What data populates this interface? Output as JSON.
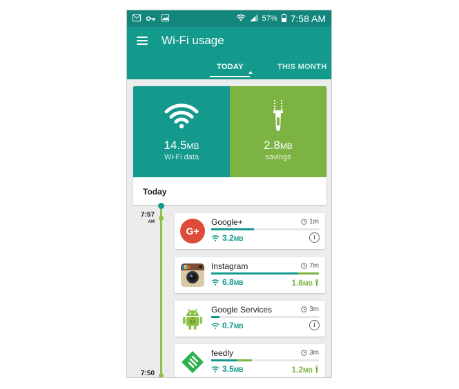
{
  "status_bar": {
    "battery": "57%",
    "time": "7:58 AM"
  },
  "header": {
    "title": "Wi-Fi usage"
  },
  "tabs": [
    {
      "label": "TODAY",
      "selected": true
    },
    {
      "label": "THIS MONTH",
      "selected": false
    }
  ],
  "summary": {
    "wifi": {
      "value": "14.5",
      "unit": "MB",
      "label": "Wi-Fi data"
    },
    "savings": {
      "value": "2.8",
      "unit": "MB",
      "label": "savings"
    },
    "period_label": "Today"
  },
  "timeline": {
    "start_time": "7:57",
    "start_ampm": "AM",
    "end_time": "7:50"
  },
  "apps": [
    {
      "name": "Google+",
      "icon": "google-plus-icon",
      "duration": "1m",
      "data": "3.2",
      "data_unit": "MB",
      "data_fraction": 0.4,
      "savings": null,
      "savings_fraction": 0
    },
    {
      "name": "Instagram",
      "icon": "instagram-icon",
      "duration": "7m",
      "data": "6.8",
      "data_unit": "MB",
      "data_fraction": 0.81,
      "savings": "1.6",
      "savings_unit": "MB",
      "savings_fraction": 0.19
    },
    {
      "name": "Google Services",
      "icon": "android-icon",
      "duration": "3m",
      "data": "0.7",
      "data_unit": "MB",
      "data_fraction": 0.08,
      "savings": null,
      "savings_fraction": 0
    },
    {
      "name": "feedly",
      "icon": "feedly-icon",
      "duration": "3m",
      "data": "3.5",
      "data_unit": "MB",
      "data_fraction": 0.24,
      "savings": "1.2",
      "savings_unit": "MB",
      "savings_fraction": 0.14
    }
  ],
  "colors": {
    "teal": "#14998d",
    "green": "#7cb342",
    "status_bar": "#12867c"
  }
}
